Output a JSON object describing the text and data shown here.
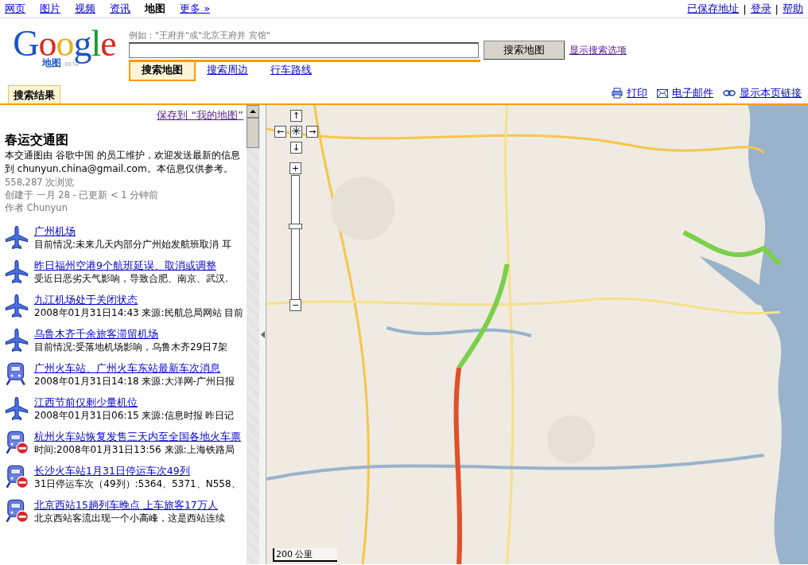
{
  "top_nav": {
    "links": [
      {
        "label": "网页",
        "selected": false
      },
      {
        "label": "图片",
        "selected": false
      },
      {
        "label": "视频",
        "selected": false
      },
      {
        "label": "资讯",
        "selected": false
      },
      {
        "label": "地图",
        "selected": true
      },
      {
        "label": "更多 »",
        "selected": false
      }
    ],
    "account_links": [
      "已保存地址",
      "登录",
      "帮助"
    ],
    "separator": "|"
  },
  "logo": {
    "wordmark": "Google",
    "product": "地图",
    "beta": "BETA"
  },
  "search": {
    "hint": "例如：\"王府井\"或\"北京王府井  宾馆\"",
    "button": "搜索地图",
    "options_link": "显示搜索选项",
    "tabs": [
      {
        "label": "搜索地图",
        "selected": true
      },
      {
        "label": "搜索周边",
        "selected": false
      },
      {
        "label": "行车路线",
        "selected": false
      }
    ]
  },
  "results_tab": "搜索结果",
  "page_actions": [
    {
      "kind": "print",
      "label": "打印"
    },
    {
      "kind": "email",
      "label": "电子邮件"
    },
    {
      "kind": "link",
      "label": "显示本页链接"
    }
  ],
  "sidebar": {
    "save_link": "保存到 “我的地图”",
    "title": "春运交通图",
    "description": "本交通图由  谷歌中国  的员工维护，欢迎发送最新的信息到  chunyun.china@gmail.com。本信息仅供参考。",
    "views": "558,287 次浏览",
    "created": "创建于  一月  28 - 已更新  < 1 分钟前",
    "author": "作者  Chunyun",
    "items": [
      {
        "kind": "plane",
        "title": "广州机场",
        "snippet": "目前情况:未来几天内部分广州始发航班取消  耳"
      },
      {
        "kind": "plane",
        "title": "昨日福州空港9个航班延误、取消或调整",
        "snippet": "受近日恶劣天气影响，导致合肥、南京、武汉."
      },
      {
        "kind": "plane",
        "title": "九江机场处于关闭状态",
        "snippet": "2008年01月31日14:43 来源:民航总局网站  目前"
      },
      {
        "kind": "plane",
        "title": "乌鲁木齐千余旅客滞留机场",
        "snippet": "目前情况:受落地机场影响，乌鲁木齐29日7架"
      },
      {
        "kind": "train",
        "blocked": false,
        "title": "广州火车站、广州火车东站最新车次消息",
        "snippet": "2008年01月31日14:18 来源:大洋网-广州日报"
      },
      {
        "kind": "plane",
        "title": "江西节前仅剩少量机位",
        "snippet": "2008年01月31日06:15 来源:信息时报  昨日记"
      },
      {
        "kind": "train",
        "blocked": true,
        "title": "杭州火车站恢复发售三天内至全国各地火车票",
        "snippet": "时间:2008年01月31日13:56 来源:上海铁路局"
      },
      {
        "kind": "train",
        "blocked": true,
        "title": "长沙火车站1月31日停运车次49列",
        "snippet": "31日停运车次（49列）:5364、5371、N558、"
      },
      {
        "kind": "train",
        "blocked": true,
        "title": "北京西站15趟列车晚点  上车旅客17万人",
        "snippet": "北京西站客流出现一个小高峰，这是西站连续"
      }
    ]
  },
  "map": {
    "kind": "picture",
    "pan": {
      "up": "↑",
      "left": "←",
      "right": "→",
      "down": "↓"
    },
    "zoom_in": "+",
    "zoom_out": "−",
    "zoom": {
      "level": 0.6
    },
    "scale": "200 公里"
  }
}
